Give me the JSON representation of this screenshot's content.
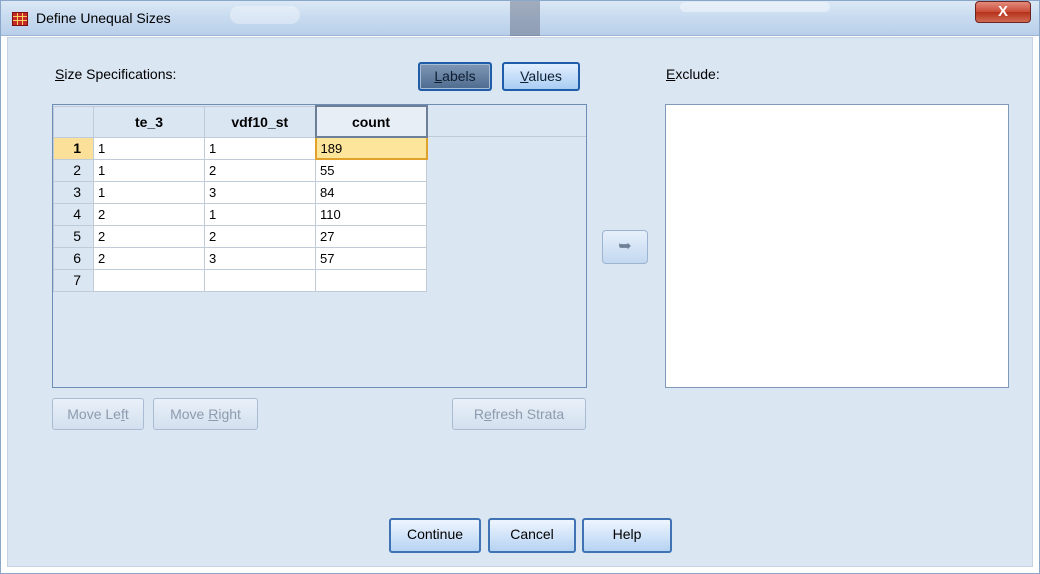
{
  "window": {
    "title": "Define Unequal Sizes",
    "close_label": "X"
  },
  "size_spec": {
    "label_prefix": "",
    "label_u": "S",
    "label_rest": "ize Specifications:",
    "labels_btn": {
      "u": "L",
      "rest": "abels"
    },
    "values_btn": {
      "u": "V",
      "rest": "alues"
    }
  },
  "grid": {
    "columns": [
      "te_3",
      "vdf10_st",
      "count"
    ],
    "rows": [
      {
        "n": "1",
        "cells": [
          "1",
          "1",
          "189"
        ]
      },
      {
        "n": "2",
        "cells": [
          "1",
          "2",
          "55"
        ]
      },
      {
        "n": "3",
        "cells": [
          "1",
          "3",
          "84"
        ]
      },
      {
        "n": "4",
        "cells": [
          "2",
          "1",
          "110"
        ]
      },
      {
        "n": "5",
        "cells": [
          "2",
          "2",
          "27"
        ]
      },
      {
        "n": "6",
        "cells": [
          "2",
          "3",
          "57"
        ]
      },
      {
        "n": "7",
        "cells": [
          "",
          "",
          ""
        ]
      }
    ]
  },
  "buttons": {
    "move_left": {
      "a": "Move Le",
      "u": "f",
      "b": "t"
    },
    "move_right": {
      "a": "Move ",
      "u": "R",
      "b": "ight"
    },
    "refresh": {
      "a": "R",
      "u": "e",
      "b": "fresh Strata"
    },
    "continue": "Continue",
    "cancel": "Cancel",
    "help": "Help",
    "arrow_icon": "➥"
  },
  "exclude": {
    "u": "E",
    "rest": "xclude:"
  },
  "colors": {
    "active_cell": "#fde59c",
    "title_bg": "#c6d9ef",
    "client_bg": "#dbe6f3"
  }
}
